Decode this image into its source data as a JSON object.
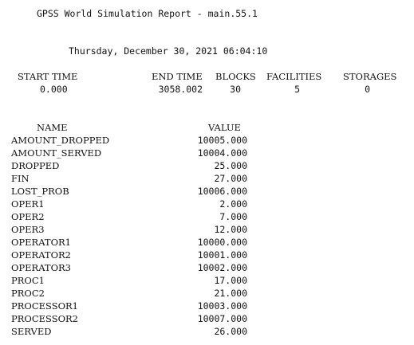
{
  "report": {
    "title": "GPSS World Simulation Report - main.55.1",
    "datetime": "Thursday, December 30, 2021 06:04:10"
  },
  "summary": {
    "headers": {
      "start_time": "START TIME",
      "end_time": "END TIME",
      "blocks": "BLOCKS",
      "facilities": "FACILITIES",
      "storages": "STORAGES"
    },
    "values": {
      "start_time": "0.000",
      "end_time": "3058.002",
      "blocks": "30",
      "facilities": "5",
      "storages": "0"
    }
  },
  "names_table": {
    "headers": {
      "name": "NAME",
      "value": "VALUE"
    },
    "rows": [
      {
        "name": "AMOUNT_DROPPED",
        "value": "10005.000"
      },
      {
        "name": "AMOUNT_SERVED",
        "value": "10004.000"
      },
      {
        "name": "DROPPED",
        "value": "25.000"
      },
      {
        "name": "FIN",
        "value": "27.000"
      },
      {
        "name": "LOST_PROB",
        "value": "10006.000"
      },
      {
        "name": "OPER1",
        "value": "2.000"
      },
      {
        "name": "OPER2",
        "value": "7.000"
      },
      {
        "name": "OPER3",
        "value": "12.000"
      },
      {
        "name": "OPERATOR1",
        "value": "10000.000"
      },
      {
        "name": "OPERATOR2",
        "value": "10001.000"
      },
      {
        "name": "OPERATOR3",
        "value": "10002.000"
      },
      {
        "name": "PROC1",
        "value": "17.000"
      },
      {
        "name": "PROC2",
        "value": "21.000"
      },
      {
        "name": "PROCESSOR1",
        "value": "10003.000"
      },
      {
        "name": "PROCESSOR2",
        "value": "10007.000"
      },
      {
        "name": "SERVED",
        "value": "26.000"
      }
    ]
  }
}
